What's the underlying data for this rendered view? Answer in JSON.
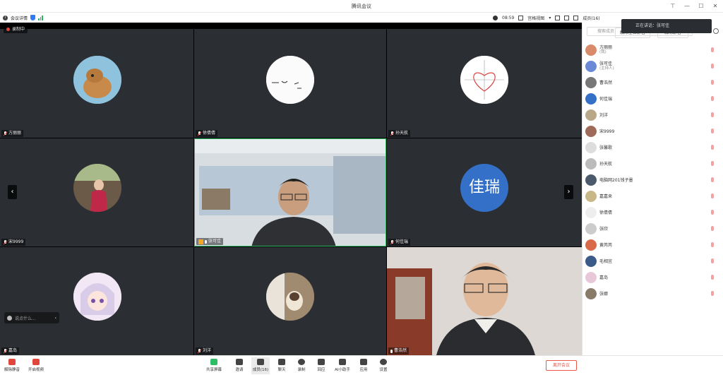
{
  "window": {
    "title": "腾讯会议"
  },
  "toolbar": {
    "meeting_info": "会议详情",
    "timer": "08:59",
    "view_label": "宫格视图",
    "members_label": "成员(16)"
  },
  "recording": {
    "label": "录制中"
  },
  "speaking": {
    "label": "正在讲话：张可佳"
  },
  "tiles": [
    {
      "name": "方丽丽"
    },
    {
      "name": "徐倩倩"
    },
    {
      "name": "孙天航"
    },
    {
      "name": "宋9999"
    },
    {
      "name": "张可佳"
    },
    {
      "name": "何佳瑞",
      "avatar_text": "佳瑞"
    },
    {
      "name": "嘉岛"
    },
    {
      "name": "刘洋"
    },
    {
      "name": "曹浩然"
    }
  ],
  "chat": {
    "placeholder": "说点什么..."
  },
  "panel": {
    "search_placeholder": "搜索成员",
    "members": [
      {
        "name": "方丽丽",
        "role": "(我)"
      },
      {
        "name": "张可佳",
        "role": "(主持人)"
      },
      {
        "name": "曹浩然",
        "role": ""
      },
      {
        "name": "何佳瑞",
        "role": ""
      },
      {
        "name": "刘洋",
        "role": ""
      },
      {
        "name": "宋9999",
        "role": ""
      },
      {
        "name": "张馨歌",
        "role": ""
      },
      {
        "name": "孙天航",
        "role": ""
      },
      {
        "name": "电脑网201钱子墨",
        "role": ""
      },
      {
        "name": "嘉嘉来",
        "role": ""
      },
      {
        "name": "徐倩倩",
        "role": ""
      },
      {
        "name": "张欣",
        "role": ""
      },
      {
        "name": "黄芮芮",
        "role": ""
      },
      {
        "name": "毛相宜",
        "role": ""
      },
      {
        "name": "嘉岛",
        "role": ""
      },
      {
        "name": "张娜",
        "role": ""
      }
    ],
    "remove_mute_label": "解除全体静音",
    "unmute_label": "解除静音"
  },
  "bottombar": {
    "unmute": "解除静音",
    "video": "开启视频",
    "share": "共享屏幕",
    "invite": "邀请",
    "members": "成员(16)",
    "chat": "聊天",
    "record": "录制",
    "reactions": "回应",
    "ai": "AI小助手",
    "apps": "应用",
    "settings": "设置",
    "leave": "离开会议"
  }
}
